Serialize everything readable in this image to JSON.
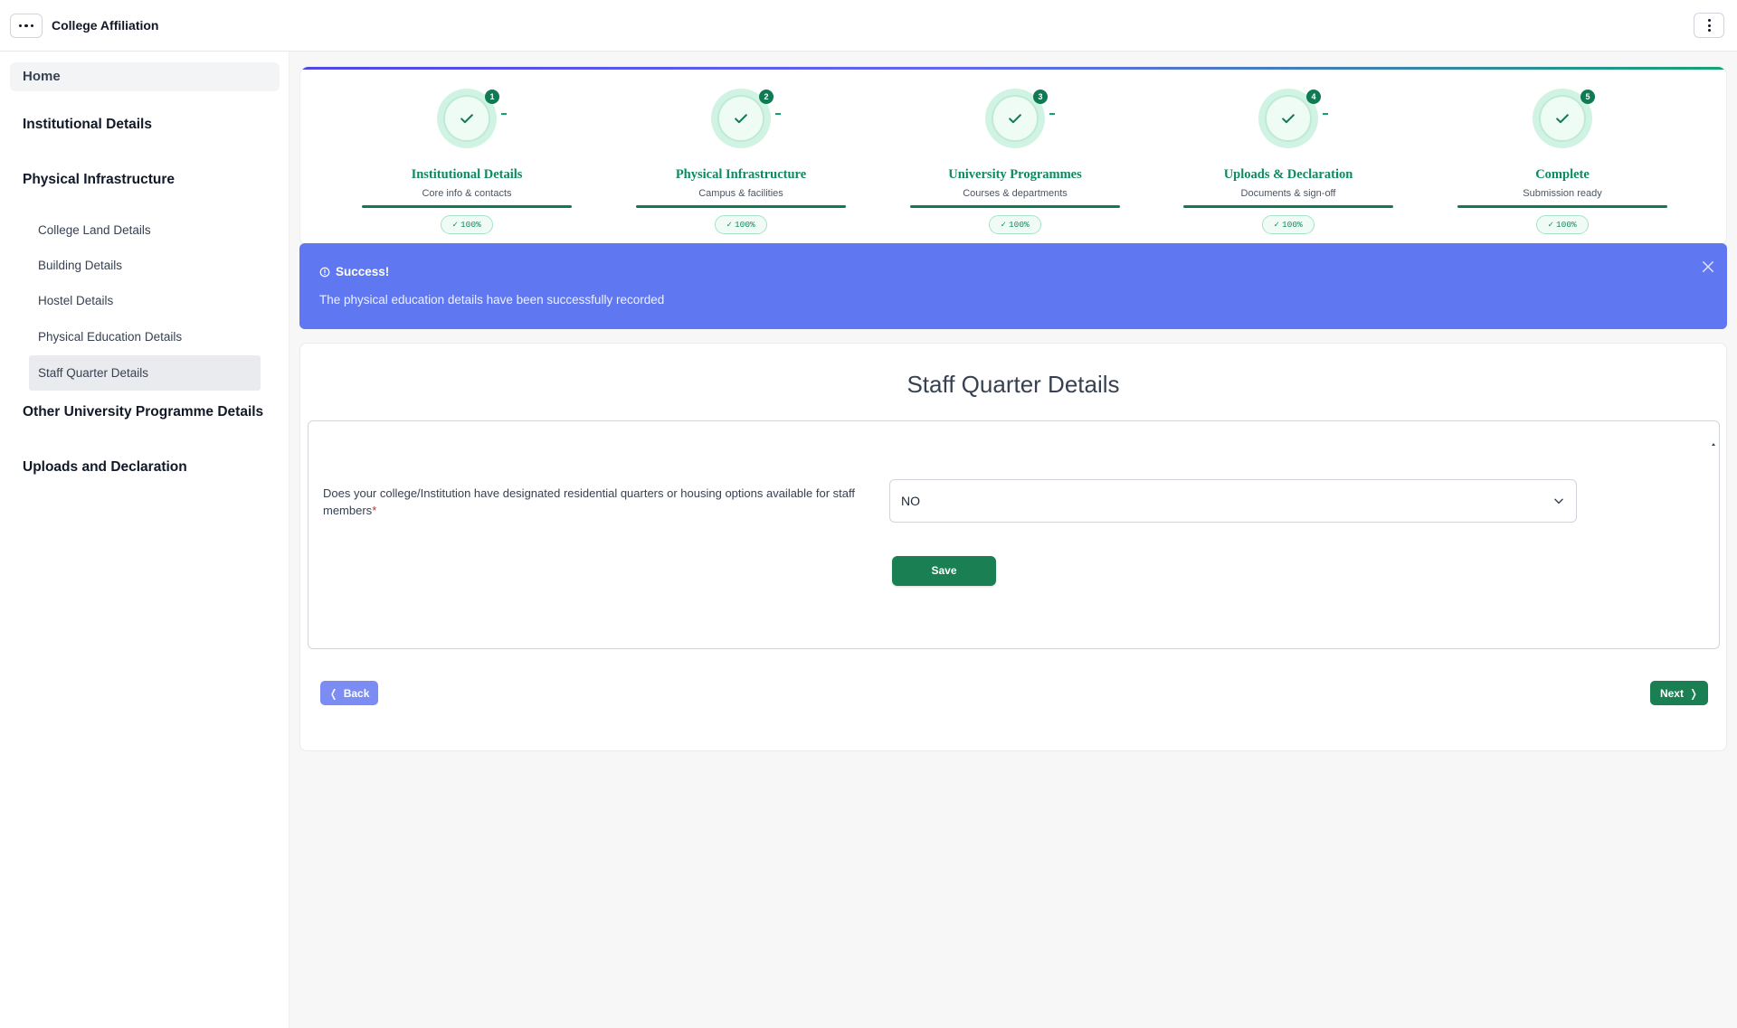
{
  "app": {
    "title": "College Affiliation"
  },
  "sidebar": {
    "home": "Home",
    "sections": [
      {
        "label": "Institutional Details"
      },
      {
        "label": "Physical Infrastructure"
      },
      {
        "label": "Other University Programme Details"
      },
      {
        "label": "Uploads and Declaration"
      }
    ],
    "sub_items": [
      {
        "label": "College Land Details"
      },
      {
        "label": "Building Details"
      },
      {
        "label": "Hostel Details"
      },
      {
        "label": "Physical Education Details"
      },
      {
        "label": "Staff Quarter Details",
        "active": true
      }
    ]
  },
  "stepper": {
    "accent_color": "#0f8a5f",
    "steps": [
      {
        "number": "1",
        "title": "Institutional Details",
        "subtitle": "Core info & contacts",
        "progress": "100%",
        "dash": "-"
      },
      {
        "number": "2",
        "title": "Physical Infrastructure",
        "subtitle": "Campus & facilities",
        "progress": "100%",
        "dash": "-"
      },
      {
        "number": "3",
        "title": "University Programmes",
        "subtitle": "Courses & departments",
        "progress": "100%",
        "dash": "-"
      },
      {
        "number": "4",
        "title": "Uploads & Declaration",
        "subtitle": "Documents & sign-off",
        "progress": "100%",
        "dash": "-"
      },
      {
        "number": "5",
        "title": "Complete",
        "subtitle": "Submission ready",
        "progress": "100%"
      }
    ]
  },
  "alert": {
    "title": "Success!",
    "message": "The physical education details have been successfully recorded",
    "color": "#5f77f1"
  },
  "form": {
    "title": "Staff Quarter Details",
    "question": "Does your college/Institution have designated residential quarters or housing options available for staff members",
    "required_mark": "*",
    "selected_value": "NO",
    "save_label": "Save"
  },
  "nav": {
    "back_label": "Back",
    "next_label": "Next"
  }
}
